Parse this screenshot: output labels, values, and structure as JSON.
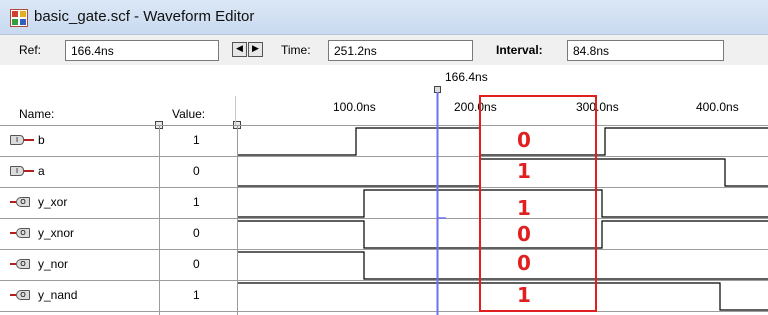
{
  "window": {
    "title": "basic_gate.scf - Waveform Editor"
  },
  "toolbar": {
    "ref_label": "Ref:",
    "ref_value": "166.4ns",
    "time_label": "Time:",
    "time_value": "251.2ns",
    "interval_label": "Interval:",
    "interval_value": "84.8ns"
  },
  "timeline": {
    "reference_marker_label": "166.4ns",
    "ticks": [
      "100.0ns",
      "200.0ns",
      "300.0ns",
      "400.0ns"
    ]
  },
  "columns": {
    "name_header": "Name:",
    "value_header": "Value:"
  },
  "signals": [
    {
      "name": "b",
      "direction": "input",
      "value": "1",
      "overlay_value": "0"
    },
    {
      "name": "a",
      "direction": "input",
      "value": "0",
      "overlay_value": "1"
    },
    {
      "name": "y_xor",
      "direction": "output",
      "value": "1",
      "overlay_value": "1"
    },
    {
      "name": "y_xnor",
      "direction": "output",
      "value": "0",
      "overlay_value": "0"
    },
    {
      "name": "y_nor",
      "direction": "output",
      "value": "0",
      "overlay_value": "0"
    },
    {
      "name": "y_nand",
      "direction": "output",
      "value": "1",
      "overlay_value": "1"
    }
  ],
  "colors": {
    "cursor_line": "#6f72ee",
    "highlight_box": "#e02020",
    "overlay_text": "#e02020",
    "pin_lead": "#b02020"
  }
}
